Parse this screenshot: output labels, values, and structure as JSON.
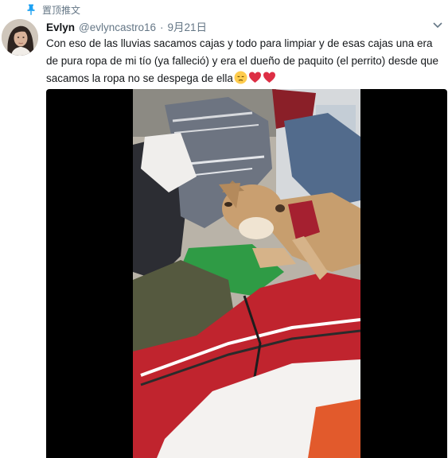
{
  "pinned": {
    "label": "置顶推文",
    "icon": "pin-icon",
    "color": "#1da1f2"
  },
  "tweet": {
    "display_name": "Evlyn",
    "handle": "@evlyncastro16",
    "separator": "·",
    "date": "9月21日",
    "text": "Con eso de las lluvias sacamos cajas y todo para limpiar y de esas cajas una era de pura ropa de mi tío (ya falleció) y era el dueño de paquito (el perrito) desde que sacamos la ropa no se despega de ella",
    "emojis": [
      "pensive-face",
      "red-heart",
      "red-heart"
    ],
    "menu_icon": "chevron-down-icon"
  },
  "media": {
    "type": "video",
    "background": "#000000",
    "subject": "dog-lying-on-pile-of-clothes"
  },
  "colors": {
    "text": "#14171a",
    "secondary": "#657786",
    "heart": "#e0245e",
    "emoji_face": "#ffcc4d"
  }
}
